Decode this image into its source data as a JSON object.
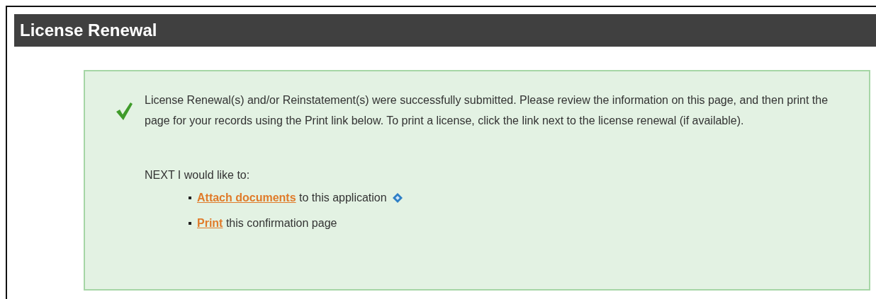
{
  "header": {
    "title": "License Renewal"
  },
  "message": {
    "kind": "success",
    "text": "License Renewal(s) and/or Reinstatement(s) were successfully submitted. Please review the information on this page, and then print the page for your records using the Print link below. To print a license, click the link next to the license renewal (if available).",
    "next_label": "NEXT I would like to:",
    "next_items": [
      {
        "link": "Attach documents",
        "text": "to this application",
        "info_icon": true
      },
      {
        "link": "Print",
        "text": "this confirmation page",
        "info_icon": false
      }
    ]
  }
}
